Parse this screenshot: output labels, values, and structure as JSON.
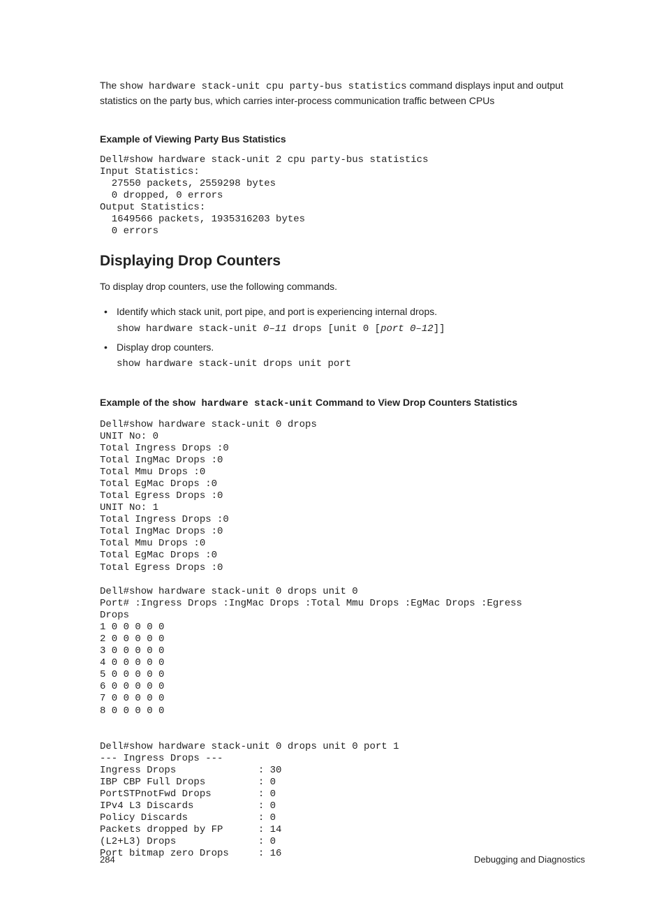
{
  "para1_prefix": "The ",
  "para1_mono": "show hardware stack-unit cpu party-bus statistics",
  "para1_suffix": " command displays input and output statistics on the party bus, which carries inter-process communication traffic between CPUs",
  "heading1": "Example of Viewing Party Bus Statistics",
  "code1": "Dell#show hardware stack-unit 2 cpu party-bus statistics\nInput Statistics:\n  27550 packets, 2559298 bytes\n  0 dropped, 0 errors\nOutput Statistics:\n  1649566 packets, 1935316203 bytes\n  0 errors",
  "h2": "Displaying Drop Counters",
  "para2": "To display drop counters, use the following commands.",
  "li1_text": "Identify which stack unit, port pipe, and port is experiencing internal drops.",
  "li1_code_a": "show hardware stack-unit ",
  "li1_code_b": "0–11",
  "li1_code_c": " drops [unit 0 [",
  "li1_code_d": "port 0–12",
  "li1_code_e": "]]",
  "li2_text": "Display drop counters.",
  "li2_code": "show hardware stack-unit drops unit port",
  "heading2_a": "Example of the ",
  "heading2_b": "show hardware stack-unit",
  "heading2_c": " Command to View Drop Counters Statistics",
  "code2": "Dell#show hardware stack-unit 0 drops\nUNIT No: 0\nTotal Ingress Drops :0\nTotal IngMac Drops :0\nTotal Mmu Drops :0\nTotal EgMac Drops :0\nTotal Egress Drops :0\nUNIT No: 1\nTotal Ingress Drops :0\nTotal IngMac Drops :0\nTotal Mmu Drops :0\nTotal EgMac Drops :0\nTotal Egress Drops :0\n\nDell#show hardware stack-unit 0 drops unit 0\nPort# :Ingress Drops :IngMac Drops :Total Mmu Drops :EgMac Drops :Egress \nDrops\n1 0 0 0 0 0\n2 0 0 0 0 0\n3 0 0 0 0 0\n4 0 0 0 0 0 \n5 0 0 0 0 0\n6 0 0 0 0 0\n7 0 0 0 0 0\n8 0 0 0 0 0\n\n\nDell#show hardware stack-unit 0 drops unit 0 port 1\n--- Ingress Drops ---\nIngress Drops              : 30\nIBP CBP Full Drops         : 0\nPortSTPnotFwd Drops        : 0\nIPv4 L3 Discards           : 0\nPolicy Discards            : 0\nPackets dropped by FP      : 14\n(L2+L3) Drops              : 0\nPort bitmap zero Drops     : 16",
  "page_number": "284",
  "footer_right": "Debugging and Diagnostics"
}
